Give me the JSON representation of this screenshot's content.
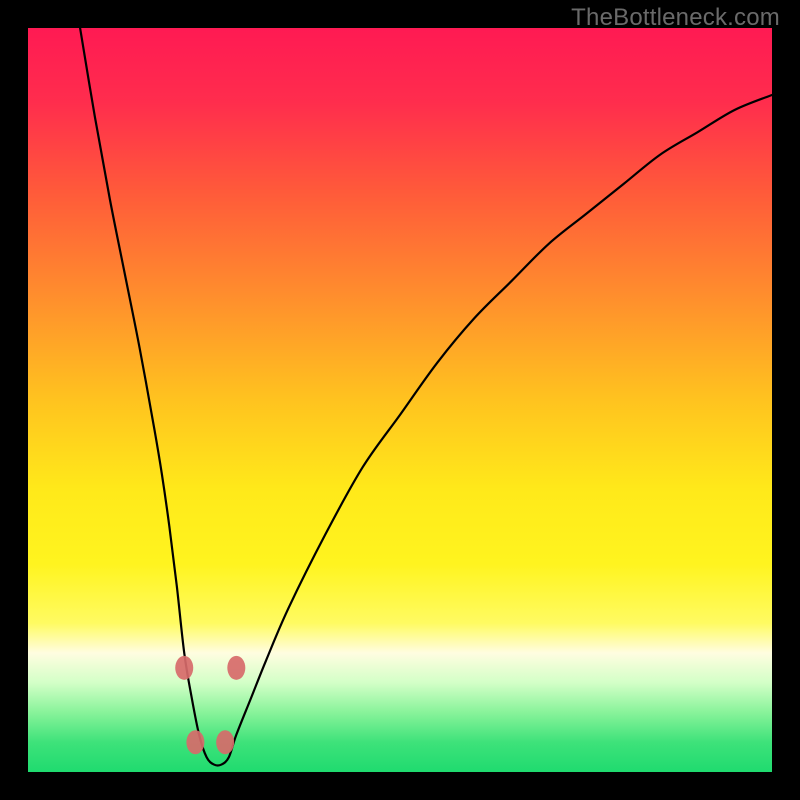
{
  "watermark": "TheBottleneck.com",
  "chart_data": {
    "type": "line",
    "title": "",
    "xlabel": "",
    "ylabel": "",
    "xlim": [
      0,
      100
    ],
    "ylim": [
      0,
      100
    ],
    "background": {
      "type": "vertical_gradient",
      "stops": [
        {
          "offset": 0.0,
          "color": "#ff1a53"
        },
        {
          "offset": 0.1,
          "color": "#ff2d4d"
        },
        {
          "offset": 0.22,
          "color": "#ff5a3a"
        },
        {
          "offset": 0.35,
          "color": "#ff8a2e"
        },
        {
          "offset": 0.5,
          "color": "#ffc31f"
        },
        {
          "offset": 0.62,
          "color": "#ffe91a"
        },
        {
          "offset": 0.72,
          "color": "#fff41f"
        },
        {
          "offset": 0.8,
          "color": "#fffb62"
        },
        {
          "offset": 0.84,
          "color": "#fffde0"
        },
        {
          "offset": 0.88,
          "color": "#d3ffc7"
        },
        {
          "offset": 0.92,
          "color": "#88f39a"
        },
        {
          "offset": 0.96,
          "color": "#3ee27a"
        },
        {
          "offset": 1.0,
          "color": "#1fdb6f"
        }
      ]
    },
    "series": [
      {
        "name": "bottleneck-curve",
        "x": [
          7,
          9,
          11,
          13,
          15,
          17,
          18,
          19,
          20,
          21,
          22,
          23,
          24,
          25,
          26,
          27,
          28,
          30,
          32,
          35,
          40,
          45,
          50,
          55,
          60,
          65,
          70,
          75,
          80,
          85,
          90,
          95,
          100
        ],
        "y": [
          100,
          88,
          77,
          67,
          57,
          46,
          40,
          33,
          25,
          16,
          10,
          5,
          2,
          1,
          1,
          2,
          5,
          10,
          15,
          22,
          32,
          41,
          48,
          55,
          61,
          66,
          71,
          75,
          79,
          83,
          86,
          89,
          91
        ]
      }
    ],
    "markers": [
      {
        "x": 21.0,
        "y": 14,
        "color": "#d76a6a"
      },
      {
        "x": 22.5,
        "y": 4,
        "color": "#d76a6a"
      },
      {
        "x": 26.5,
        "y": 4,
        "color": "#d76a6a"
      },
      {
        "x": 28.0,
        "y": 14,
        "color": "#d76a6a"
      }
    ]
  }
}
